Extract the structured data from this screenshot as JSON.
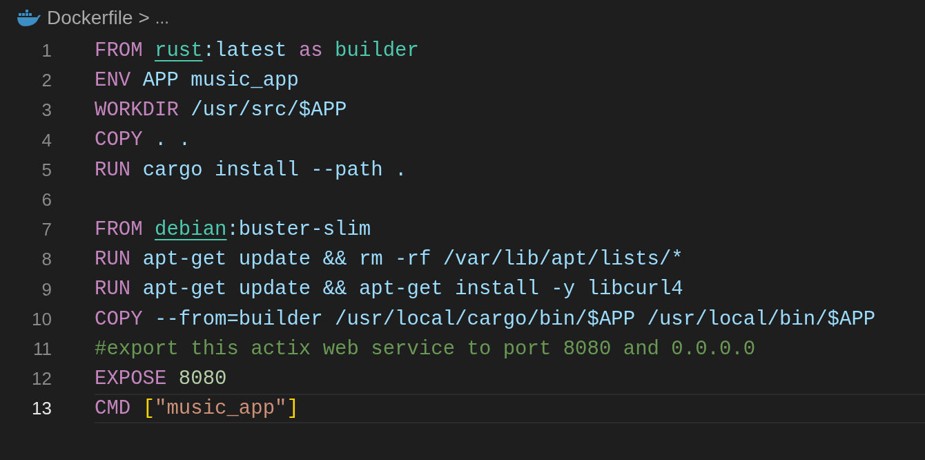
{
  "breadcrumb": {
    "file": "Dockerfile",
    "separator": ">",
    "ellipsis": "..."
  },
  "lines": [
    {
      "number": "1",
      "current": false,
      "tokens": [
        {
          "kind": "keyword",
          "text": "FROM "
        },
        {
          "kind": "image",
          "text": "rust"
        },
        {
          "kind": "plain",
          "text": ":latest "
        },
        {
          "kind": "keyword",
          "text": "as "
        },
        {
          "kind": "stage",
          "text": "builder"
        }
      ]
    },
    {
      "number": "2",
      "current": false,
      "tokens": [
        {
          "kind": "keyword",
          "text": "ENV "
        },
        {
          "kind": "plain",
          "text": "APP music_app"
        }
      ]
    },
    {
      "number": "3",
      "current": false,
      "tokens": [
        {
          "kind": "keyword",
          "text": "WORKDIR "
        },
        {
          "kind": "plain",
          "text": "/usr/src/$APP"
        }
      ]
    },
    {
      "number": "4",
      "current": false,
      "tokens": [
        {
          "kind": "keyword",
          "text": "COPY "
        },
        {
          "kind": "plain",
          "text": ". ."
        }
      ]
    },
    {
      "number": "5",
      "current": false,
      "tokens": [
        {
          "kind": "keyword",
          "text": "RUN "
        },
        {
          "kind": "plain",
          "text": "cargo install --path ."
        }
      ]
    },
    {
      "number": "6",
      "current": false
    },
    {
      "number": "7",
      "current": false,
      "tokens": [
        {
          "kind": "keyword",
          "text": "FROM "
        },
        {
          "kind": "image",
          "text": "debian"
        },
        {
          "kind": "plain",
          "text": ":buster-slim"
        }
      ]
    },
    {
      "number": "8",
      "current": false,
      "tokens": [
        {
          "kind": "keyword",
          "text": "RUN "
        },
        {
          "kind": "plain",
          "text": "apt-get update && rm -rf /var/lib/apt/lists/*"
        }
      ]
    },
    {
      "number": "9",
      "current": false,
      "tokens": [
        {
          "kind": "keyword",
          "text": "RUN "
        },
        {
          "kind": "plain",
          "text": "apt-get update && apt-get install -y libcurl4"
        }
      ]
    },
    {
      "number": "10",
      "current": false,
      "tokens": [
        {
          "kind": "keyword",
          "text": "COPY "
        },
        {
          "kind": "plain",
          "text": "--from=builder /usr/local/cargo/bin/$APP /usr/local/bin/$APP"
        }
      ]
    },
    {
      "number": "11",
      "current": false,
      "tokens": [
        {
          "kind": "comment",
          "text": "#export this actix web service to port 8080 and 0.0.0.0"
        }
      ]
    },
    {
      "number": "12",
      "current": false,
      "tokens": [
        {
          "kind": "keyword",
          "text": "EXPOSE "
        },
        {
          "kind": "number",
          "text": "8080"
        }
      ]
    },
    {
      "number": "13",
      "current": true,
      "tokens": [
        {
          "kind": "keyword",
          "text": "CMD "
        },
        {
          "kind": "bracket",
          "text": "["
        },
        {
          "kind": "string",
          "text": "\"music_app\""
        },
        {
          "kind": "bracket",
          "text": "]"
        }
      ]
    }
  ]
}
